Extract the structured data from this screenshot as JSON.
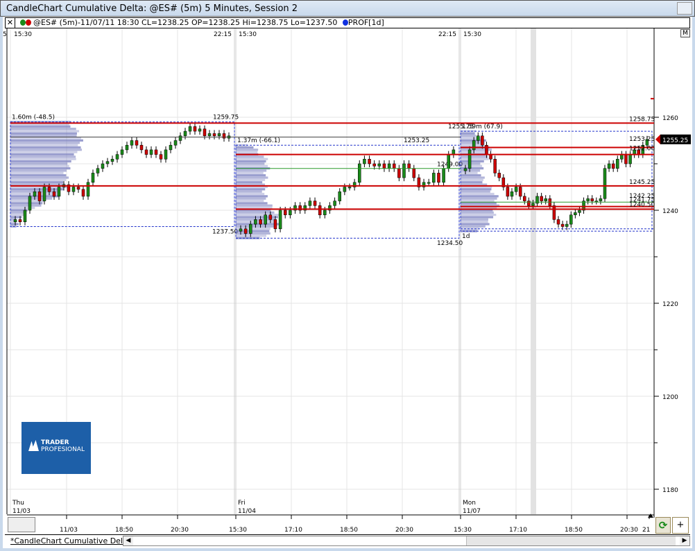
{
  "window": {
    "title": "CandleChart Cumulative Delta: @ES# (5m) 5 Minutes, Session 2"
  },
  "legend": {
    "close_label": "✕",
    "symbol_info": "@ES# (5m)-11/07/11 18:30 CL=1238.25 OP=1238.25 Hi=1238.75 Lo=1237.50",
    "study": "PROF[1d]",
    "m_button": "M"
  },
  "colors": {
    "up": "#1a8a1a",
    "down": "#cc0000",
    "level": "#cc0000",
    "poc": "#2a9a2a",
    "profile": "#6d72b8",
    "range_box": "#2233cc",
    "price_tag": "#cc0000"
  },
  "top_time_labels": [
    "5",
    "15:30",
    "22:15",
    "15:30",
    "22:15",
    "15:30"
  ],
  "sessions": [
    {
      "day": "Thu",
      "date": "11/03",
      "volume_label": "1.60m (-48.5)",
      "high": "1259.75",
      "low": "1237.50",
      "closes": [
        1238,
        1237.5,
        1240,
        1243,
        1244,
        1242,
        1245,
        1244,
        1243,
        1245,
        1245.5,
        1244,
        1245,
        1244.5,
        1243,
        1246,
        1248,
        1249,
        1250,
        1250.5,
        1251,
        1252,
        1253,
        1254,
        1255,
        1254,
        1253,
        1252,
        1253,
        1252,
        1251,
        1253,
        1254,
        1255,
        1256,
        1257,
        1258,
        1257,
        1257.5,
        1256,
        1256.5,
        1256,
        1256.5,
        1255.5,
        1256
      ]
    },
    {
      "day": "Fri",
      "date": "11/04",
      "volume_label": "1.37m (-66.1)",
      "high": "1253.25",
      "low": "1234.50",
      "poc": "1249.00",
      "closes": [
        1236,
        1235,
        1237,
        1238,
        1237,
        1239,
        1238,
        1236,
        1240,
        1239,
        1240,
        1241,
        1240,
        1241,
        1242,
        1241,
        1239,
        1240,
        1241,
        1242,
        1244,
        1245,
        1245,
        1246,
        1250,
        1251,
        1250,
        1249.5,
        1250,
        1249,
        1250,
        1249,
        1247,
        1250,
        1249,
        1247,
        1245,
        1246,
        1246,
        1248,
        1246,
        1249,
        1252,
        1253
      ]
    },
    {
      "day": "Mon",
      "date": "11/07",
      "volume_label": "1.59m (67.9)",
      "high": "1255.75",
      "low_label": "1d",
      "closes": [
        1249,
        1253,
        1255,
        1256,
        1254,
        1252,
        1251,
        1248,
        1247,
        1245,
        1243,
        1244,
        1245,
        1243,
        1242,
        1241,
        1241.5,
        1243,
        1242,
        1242.5,
        1241,
        1238,
        1237,
        1236.5,
        1237,
        1239,
        1239.5,
        1240,
        1242,
        1242.5,
        1242,
        1242,
        1242.5,
        1249,
        1250,
        1249,
        1251,
        1252,
        1250,
        1252,
        1253,
        1252,
        1254,
        1255.25
      ]
    }
  ],
  "levels": [
    "1258.75",
    "1253.25",
    "1252.00",
    "1245.25",
    "1242.25",
    "1241.75",
    "1240.50"
  ],
  "price_axis": {
    "labels": [
      "1260",
      "1240",
      "1220",
      "1200",
      "1180"
    ],
    "last_price": "1255.25"
  },
  "time_axis": [
    "11/03",
    "18:50",
    "20:30",
    "15:30",
    "17:10",
    "18:50",
    "20:30",
    "15:30",
    "17:10",
    "18:50",
    "20:30",
    "21"
  ],
  "logo": {
    "line1": "TRADER",
    "line2": "PROFESIONAL"
  },
  "tabs": [
    {
      "label": "*CandleChart Cumulative Delta"
    }
  ],
  "buttons": {
    "refresh": "⟳",
    "add": "+"
  }
}
